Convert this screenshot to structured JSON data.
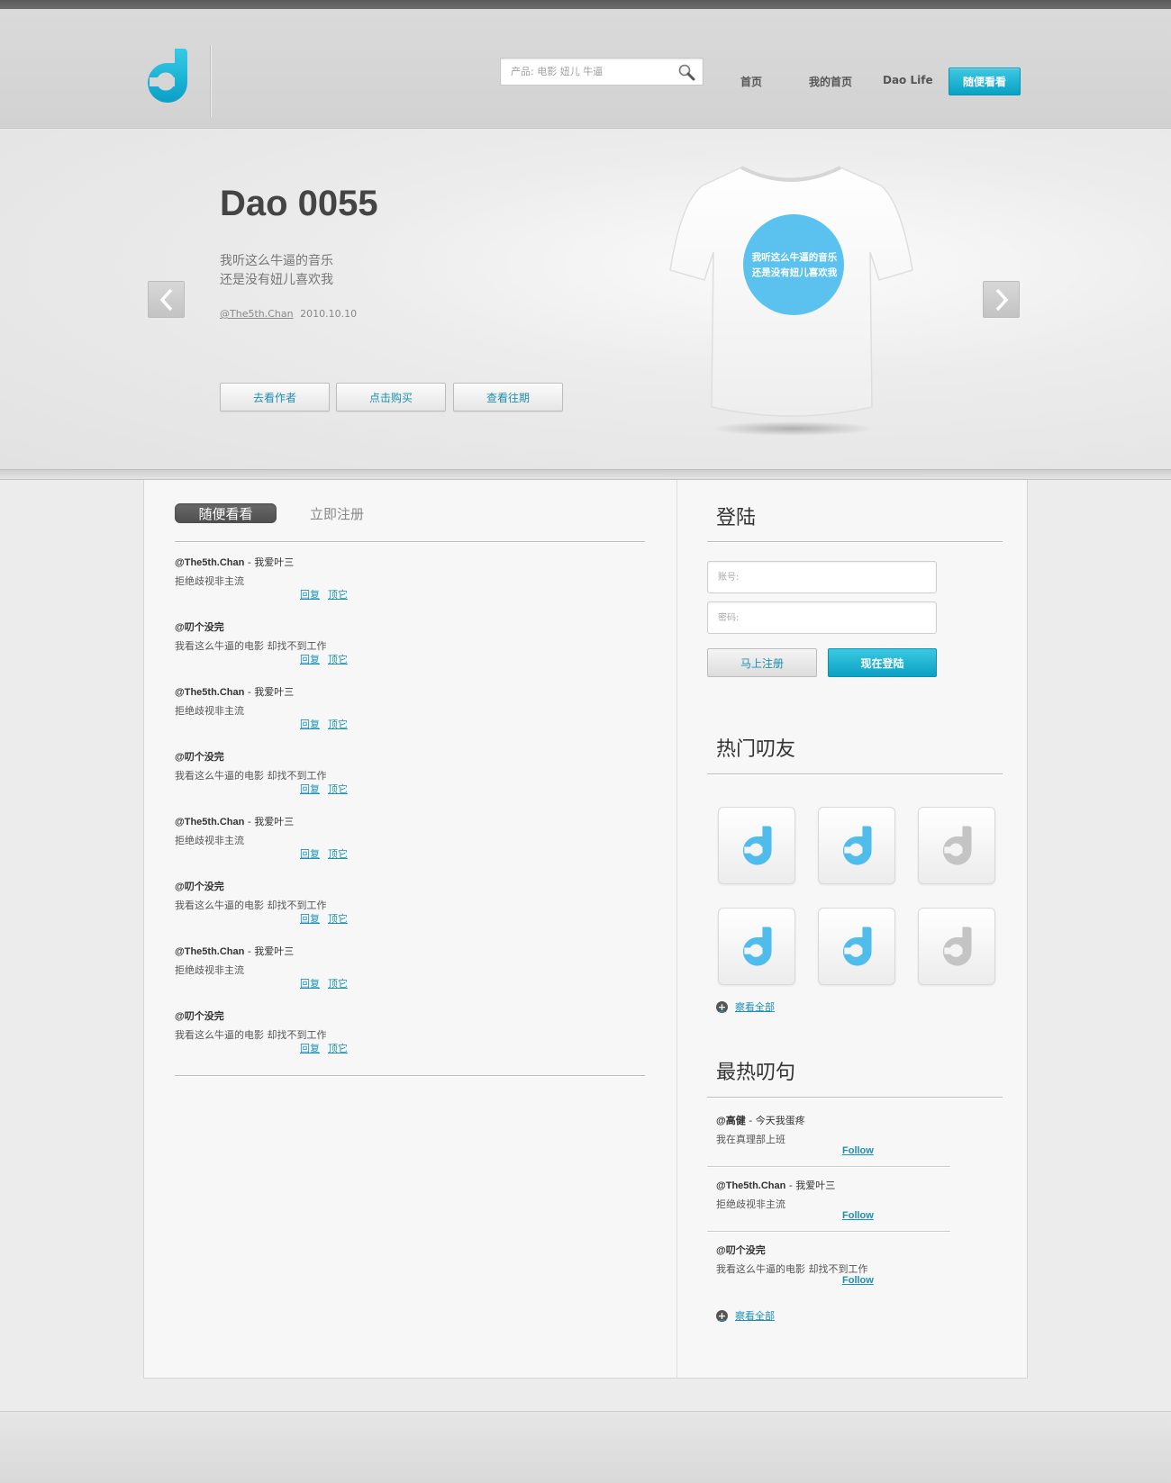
{
  "header": {
    "search_placeholder": "产品: 电影 妞儿 牛逼",
    "nav": [
      "首页",
      "我的首页",
      "Dao Life"
    ],
    "random_button": "随便看看"
  },
  "hero": {
    "title": "Dao 0055",
    "line1": "我听这么牛逼的音乐",
    "line2": "还是没有妞儿喜欢我",
    "author": "@The5th.Chan",
    "date": "2010.10.10",
    "buttons": [
      "去看作者",
      "点击购买",
      "查看往期"
    ],
    "shirt_line1": "我听这么牛逼的音乐",
    "shirt_line2": "还是没有妞儿喜欢我",
    "accent_color": "#5bc2ef"
  },
  "tabs": {
    "active": "随便看看",
    "inactive": "立即注册"
  },
  "feed": [
    {
      "user": "@The5th.Chan",
      "suffix": " - 我爱叶三",
      "text": "拒绝歧视非主流",
      "reply": "回复",
      "up": "顶它"
    },
    {
      "user": "@叨个没完",
      "suffix": "",
      "text": "我看这么牛逼的电影 却找不到工作",
      "reply": "回复",
      "up": "顶它"
    },
    {
      "user": "@The5th.Chan",
      "suffix": " - 我爱叶三",
      "text": "拒绝歧视非主流",
      "reply": "回复",
      "up": "顶它"
    },
    {
      "user": "@叨个没完",
      "suffix": "",
      "text": "我看这么牛逼的电影 却找不到工作",
      "reply": "回复",
      "up": "顶它"
    },
    {
      "user": "@The5th.Chan",
      "suffix": " - 我爱叶三",
      "text": "拒绝歧视非主流",
      "reply": "回复",
      "up": "顶它"
    },
    {
      "user": "@叨个没完",
      "suffix": "",
      "text": "我看这么牛逼的电影 却找不到工作",
      "reply": "回复",
      "up": "顶它"
    },
    {
      "user": "@The5th.Chan",
      "suffix": " - 我爱叶三",
      "text": "拒绝歧视非主流",
      "reply": "回复",
      "up": "顶它"
    },
    {
      "user": "@叨个没完",
      "suffix": "",
      "text": "我看这么牛逼的电影 却找不到工作",
      "reply": "回复",
      "up": "顶它"
    }
  ],
  "login": {
    "title": "登陆",
    "account_placeholder": "账号:",
    "password_placeholder": "密码:",
    "register_button": "马上注册",
    "login_button": "现在登陆"
  },
  "friends": {
    "title": "热门叨友",
    "view_all": "察看全部",
    "avatars": [
      "blue",
      "blue",
      "gray",
      "blue",
      "blue",
      "gray"
    ]
  },
  "hot": {
    "title": "最热叨句",
    "view_all": "察看全部",
    "items": [
      {
        "user": "@高健",
        "suffix": " - 今天我蛋疼",
        "text": "我在真理部上班",
        "follow": "Follow"
      },
      {
        "user": "@The5th.Chan",
        "suffix": " - 我爱叶三",
        "text": "拒绝歧视非主流",
        "follow": "Follow"
      },
      {
        "user": "@叨个没完",
        "suffix": "",
        "text": "我看这么牛逼的电影 却找不到工作",
        "follow": "Follow"
      }
    ]
  }
}
